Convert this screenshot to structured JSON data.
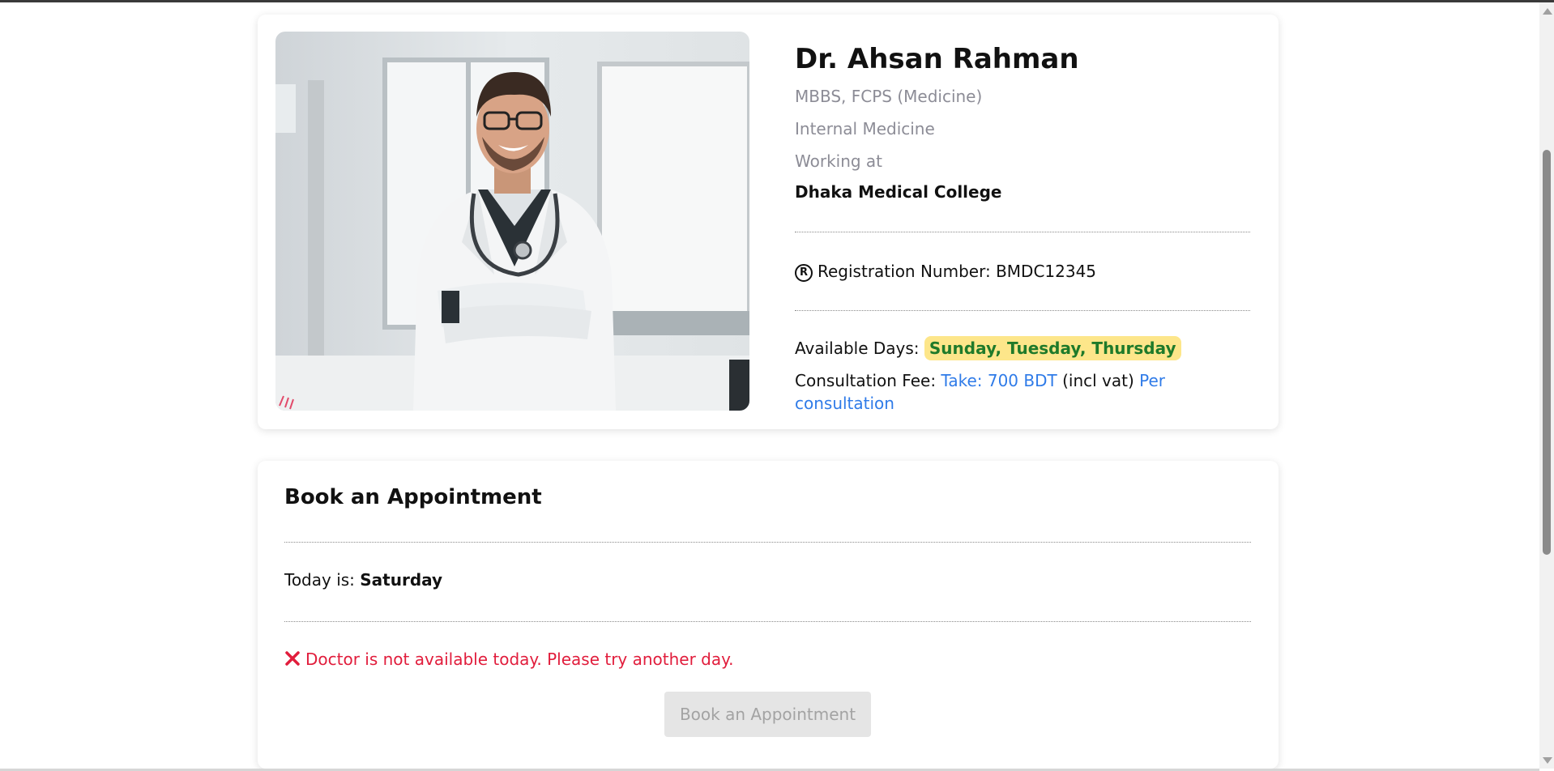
{
  "doctor": {
    "name": "Dr. Ahsan Rahman",
    "degrees": "MBBS, FCPS (Medicine)",
    "specialty": "Internal Medicine",
    "working_at_label": "Working at",
    "hospital": "Dhaka Medical College",
    "registration_label": "Registration Number:",
    "registration_number": "BMDC12345",
    "available_days_label": "Available Days:",
    "available_days": "Sunday, Tuesday, Thursday",
    "fee_label": "Consultation Fee:",
    "fee_amount": "Take: 700 BDT",
    "fee_vat": "(incl vat)",
    "fee_unit": "Per consultation",
    "photo_icon": "doctor-photo"
  },
  "booking": {
    "title": "Book an Appointment",
    "today_label": "Today is:",
    "today_value": "Saturday",
    "alert": "Doctor is not available today. Please try another day.",
    "button_label": "Book an Appointment"
  },
  "colors": {
    "accent_blue": "#2f7be8",
    "badge_bg": "#fde68a",
    "badge_text": "#1f7a2a",
    "error": "#e11d3c",
    "muted": "#8c8c96"
  }
}
